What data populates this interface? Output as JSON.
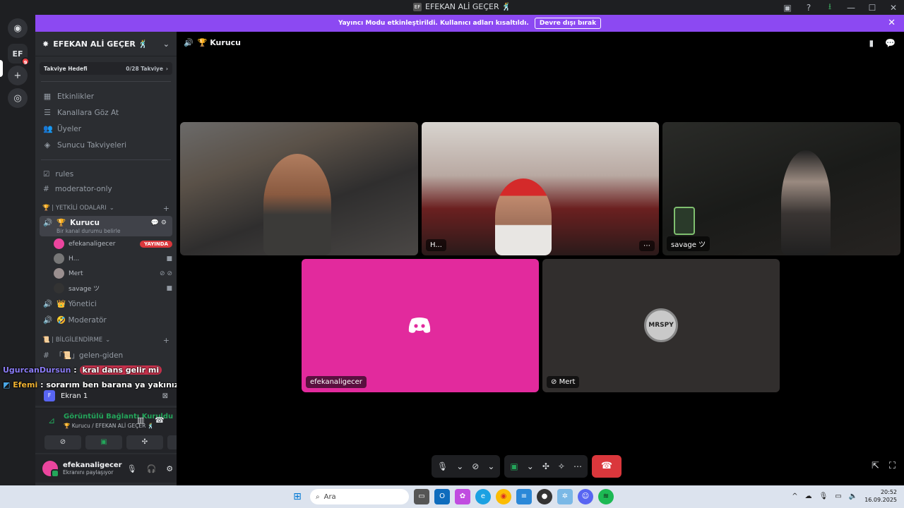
{
  "window": {
    "title": "EFEKAN ALİ GEÇER 🕺",
    "app_icon": "EF"
  },
  "banner": {
    "text": "Yayıncı Modu etkinleştirildi. Kullanıcı adları kısaltıldı.",
    "button": "Devre dışı bırak"
  },
  "servers": {
    "active_icon": "EF",
    "badge": "9"
  },
  "server": {
    "name": "EFEKAN ALİ GEÇER 🕺",
    "boost_label": "Takviye Hedefi",
    "boost_value": "0/28 Takviye"
  },
  "nav": [
    {
      "label": "Etkinlikler",
      "icon": "calendar-icon"
    },
    {
      "label": "Kanallara Göz At",
      "icon": "list-icon"
    },
    {
      "label": "Üyeler",
      "icon": "members-icon"
    },
    {
      "label": "Sunucu Takviyeleri",
      "icon": "boost-icon"
    }
  ],
  "channels_top": [
    {
      "label": "rules",
      "icon": "rules-icon"
    },
    {
      "label": "moderator-only",
      "icon": "hash-icon"
    }
  ],
  "category1": "🏆 | YETKİLİ ODALARI",
  "voice_active": {
    "name": "Kurucu",
    "status": "Bir kanal durumu belirle"
  },
  "members": [
    {
      "name": "efekanaligecer",
      "badge": "YAYINDA"
    },
    {
      "name": "H..."
    },
    {
      "name": "Mert"
    },
    {
      "name": "savage ツ"
    }
  ],
  "voice_channels": [
    {
      "name": "👑 Yönetici"
    },
    {
      "name": "🤣 Moderatör"
    }
  ],
  "category2": "📜 | BİLGİLENDİRME",
  "text_channels": [
    {
      "name": "「📜」gelen-giden"
    }
  ],
  "overlay": [
    {
      "user": "UgurcanDursun",
      "sep": " : ",
      "msg1": "kral",
      "msg2": "dans gelir mi"
    },
    {
      "user": "Efemi",
      "sep": " : ",
      "msg1": "sorarım ben barana ya yakınız"
    }
  ],
  "screen_share": {
    "label": "Ekran 1",
    "icon_letter": "F"
  },
  "voice_status": {
    "title": "Görüntülü Bağlantı Kuruldu",
    "subtitle": "🏆 Kurucu / EFEKAN ALİ GEÇER 🕺"
  },
  "user": {
    "name": "efekanaligecer",
    "status": "Ekranını paylaşıyor"
  },
  "stage": {
    "channel": "🏆 Kurucu"
  },
  "tiles": {
    "cam2_label": "H...",
    "cam3_label": "savage ツ",
    "pink_label": "efekanaligecer",
    "dark_label": "Mert",
    "avatar_text": "MRSPY"
  },
  "taskbar": {
    "search_placeholder": "Ara",
    "time": "20:52",
    "date": "16.09.2025"
  },
  "colors": {
    "accent": "#8c49f2",
    "pink": "#e22a9d",
    "green": "#23a55a",
    "red": "#da373c"
  }
}
